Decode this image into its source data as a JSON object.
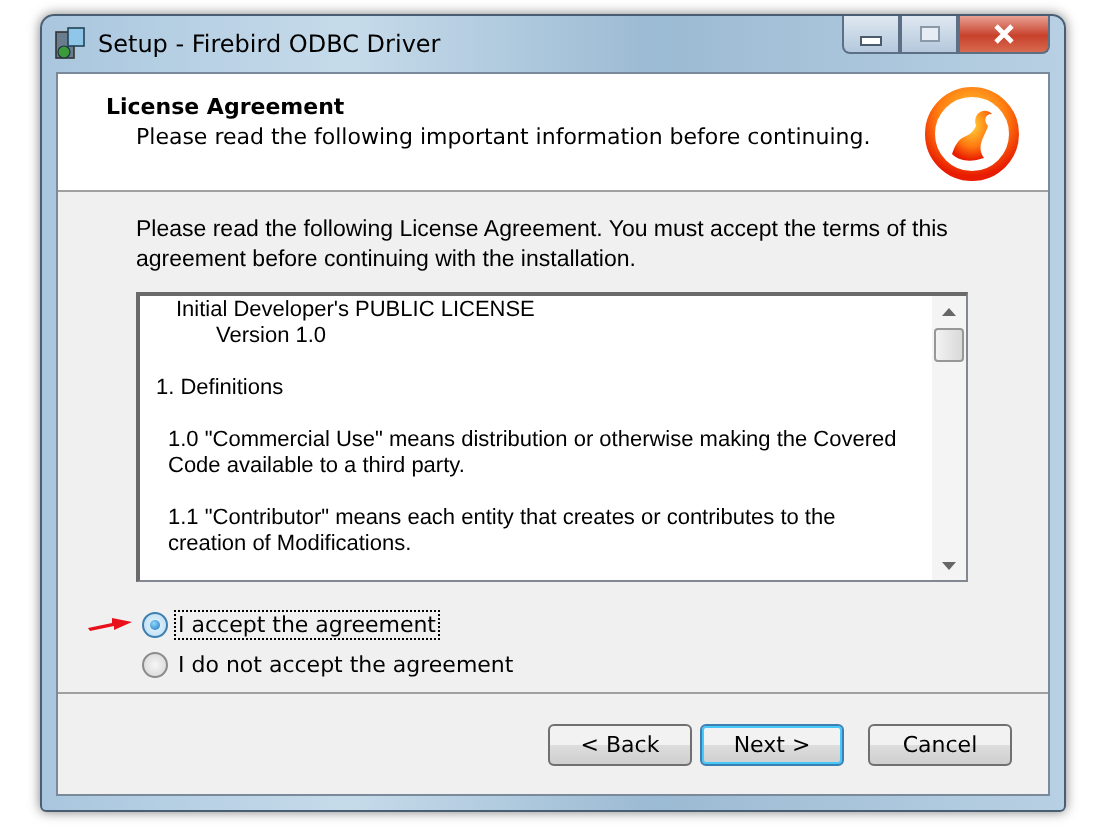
{
  "window": {
    "title": "Setup - Firebird ODBC Driver"
  },
  "header": {
    "title": "License Agreement",
    "subtitle": "Please read the following important information before continuing."
  },
  "instructions": "Please read the following License Agreement. You must accept the terms of this agreement before continuing with the installation.",
  "license_text": [
    {
      "kind": "title",
      "text": "Initial Developer's PUBLIC LICENSE"
    },
    {
      "kind": "version",
      "text": "Version 1.0"
    },
    {
      "kind": "section",
      "text": "1. Definitions"
    },
    {
      "kind": "paragraph",
      "text": "1.0 \"Commercial Use\" means distribution or otherwise making the Covered Code available to a third party."
    },
    {
      "kind": "paragraph",
      "text": "1.1 \"Contributor\" means each entity that creates or contributes to the creation of Modifications."
    }
  ],
  "options": [
    {
      "label": "I accept the agreement",
      "selected": true
    },
    {
      "label": "I do not accept the agreement",
      "selected": false
    }
  ],
  "buttons": [
    {
      "label": "< Back",
      "default": false
    },
    {
      "label": "Next >",
      "default": true
    },
    {
      "label": "Cancel",
      "default": false
    }
  ]
}
